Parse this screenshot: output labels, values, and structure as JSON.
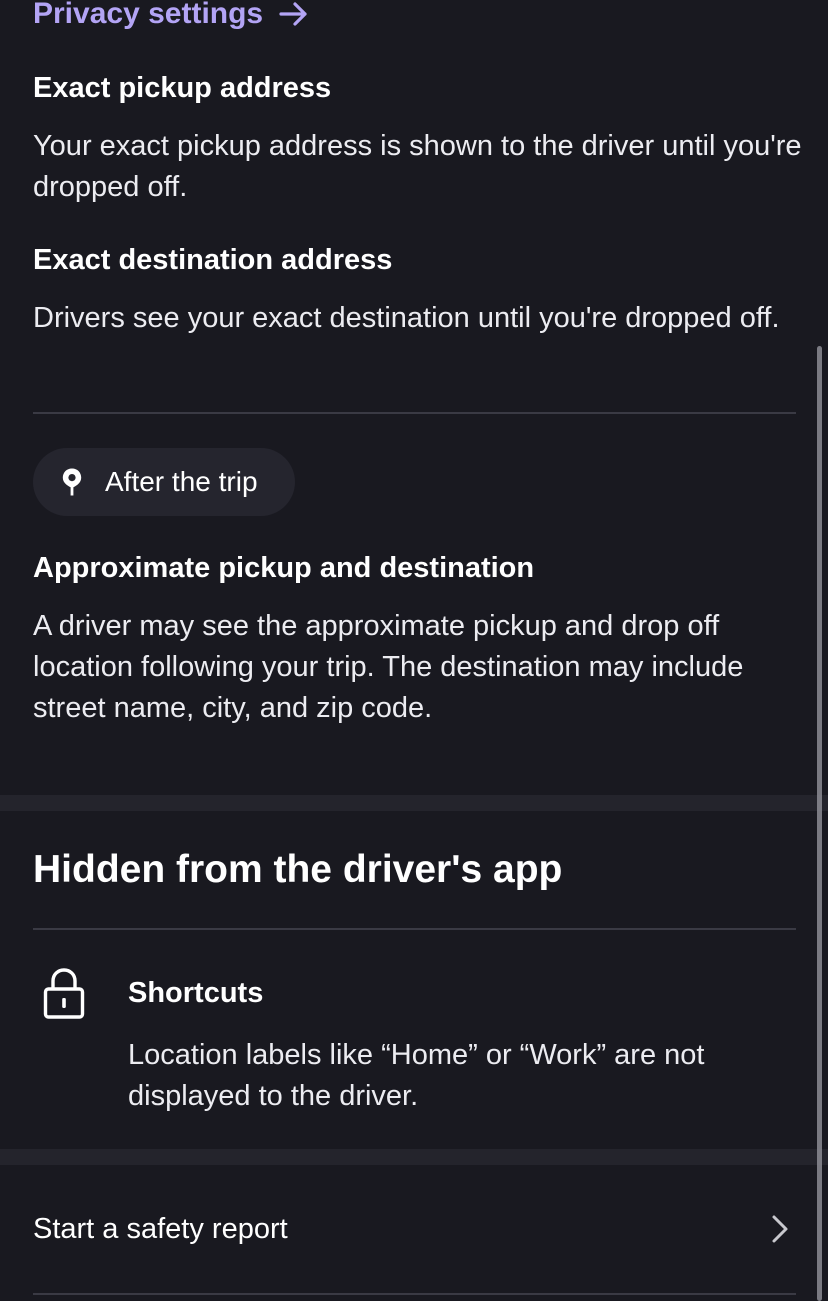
{
  "header": {
    "privacy_link": "Privacy settings",
    "arrow_icon": "arrow-right-icon"
  },
  "during_trip": {
    "pickup_title": "Exact pickup address",
    "pickup_body": "Your exact pickup address is shown to the driver until you're dropped off.",
    "destination_title": "Exact destination address",
    "destination_body": "Drivers see your exact destination until you're dropped off."
  },
  "after_trip": {
    "chip_label": "After the trip",
    "chip_icon": "location-pin-icon",
    "approx_title": "Approximate pickup and destination",
    "approx_body": "A driver may see the approximate pickup and drop off location following your trip. The destination may include street name, city, and zip code."
  },
  "hidden_section": {
    "title": "Hidden from the driver's app",
    "shortcuts_icon": "lock-icon",
    "shortcuts_title": "Shortcuts",
    "shortcuts_body": "Location labels like “Home” or “Work” are not displayed to the driver."
  },
  "safety": {
    "label": "Start a safety report",
    "chevron_icon": "chevron-right-icon"
  },
  "colors": {
    "background": "#191920",
    "accent": "#b3a4f5",
    "chip_background": "#25252e",
    "divider": "#3a3a44"
  }
}
